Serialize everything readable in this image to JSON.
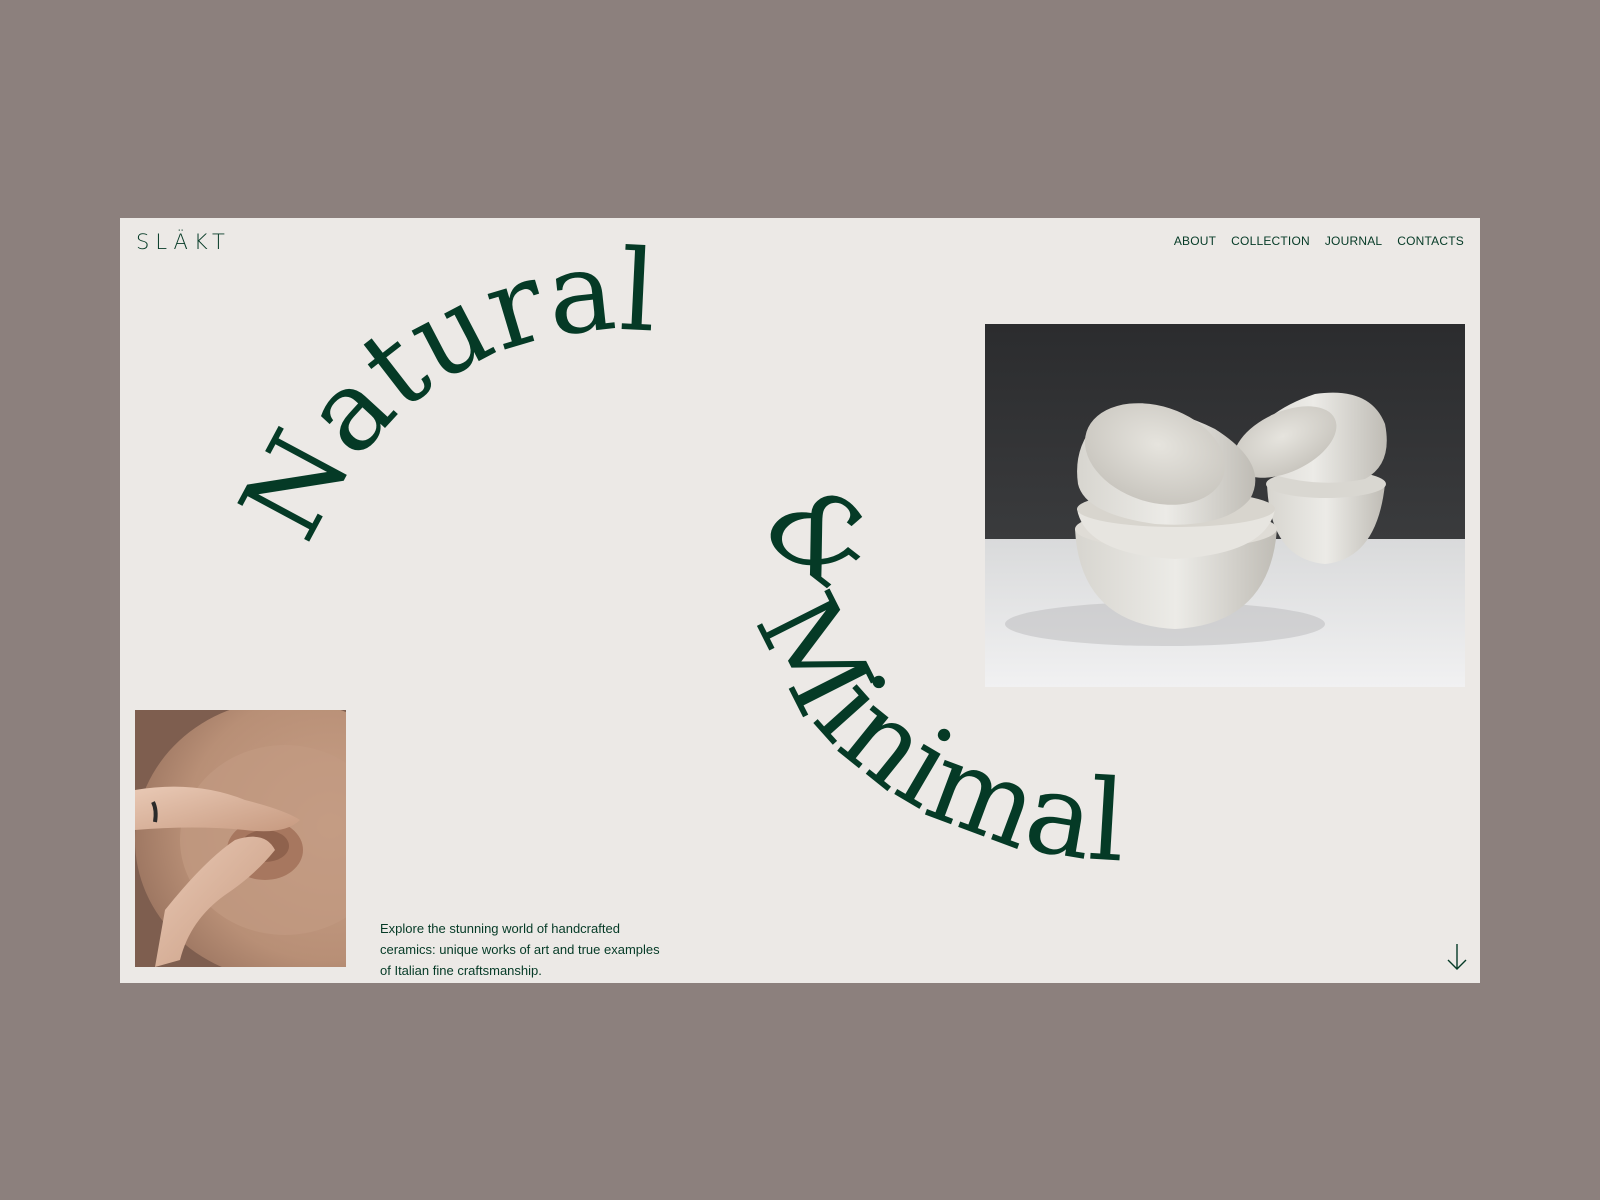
{
  "brand": {
    "logo_text": "SLÄKT"
  },
  "nav": {
    "items": [
      {
        "label": "ABOUT"
      },
      {
        "label": "COLLECTION"
      },
      {
        "label": "JOURNAL"
      },
      {
        "label": "CONTACTS"
      }
    ]
  },
  "hero": {
    "headline_part1": "Natural",
    "headline_part2": "&",
    "headline_part3": "Minimal",
    "intro": "Explore the stunning world of handcrafted ceramics: unique works of art and true examples of Italian fine craftsmanship."
  },
  "icons": {
    "scroll": "arrow-down-icon"
  },
  "colors": {
    "page_background": "#8c807d",
    "frame_background": "#ece9e6",
    "accent_green": "#053a26"
  }
}
